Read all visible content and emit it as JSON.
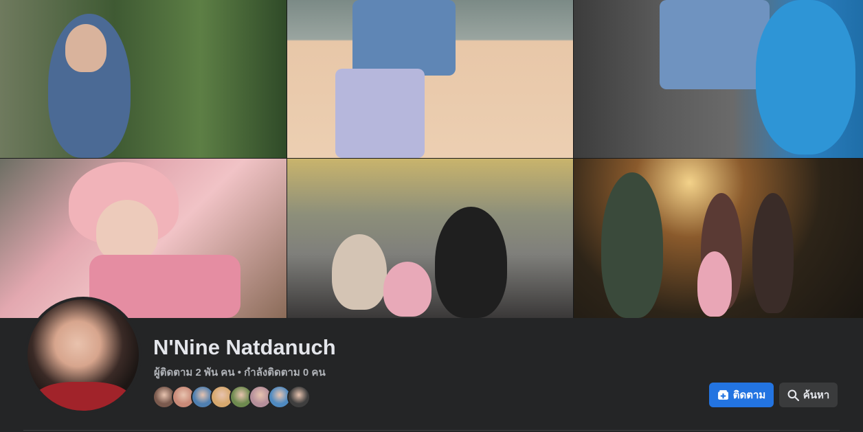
{
  "profile": {
    "name": "N'Nine Natdanuch",
    "stats": "ผู้ติดตาม 2 พัน คน • กำลังติดตาม 0 คน"
  },
  "followers_avatars": [
    {
      "color": "#7a5a4e"
    },
    {
      "color": "#c98a78"
    },
    {
      "color": "#4f7fb0"
    },
    {
      "color": "#d6a86e"
    },
    {
      "color": "#6e8a4f"
    },
    {
      "color": "#b58f9a"
    },
    {
      "color": "#4f8ac0"
    },
    {
      "color": "#3e3e3e"
    }
  ],
  "actions": {
    "follow_label": "ติดตาม",
    "search_label": "ค้นหา"
  },
  "colors": {
    "background": "#242526",
    "primary_button": "#2374e1",
    "secondary_button": "#3a3b3c",
    "text_primary": "#e4e6eb",
    "text_secondary": "#b0b3b8"
  }
}
